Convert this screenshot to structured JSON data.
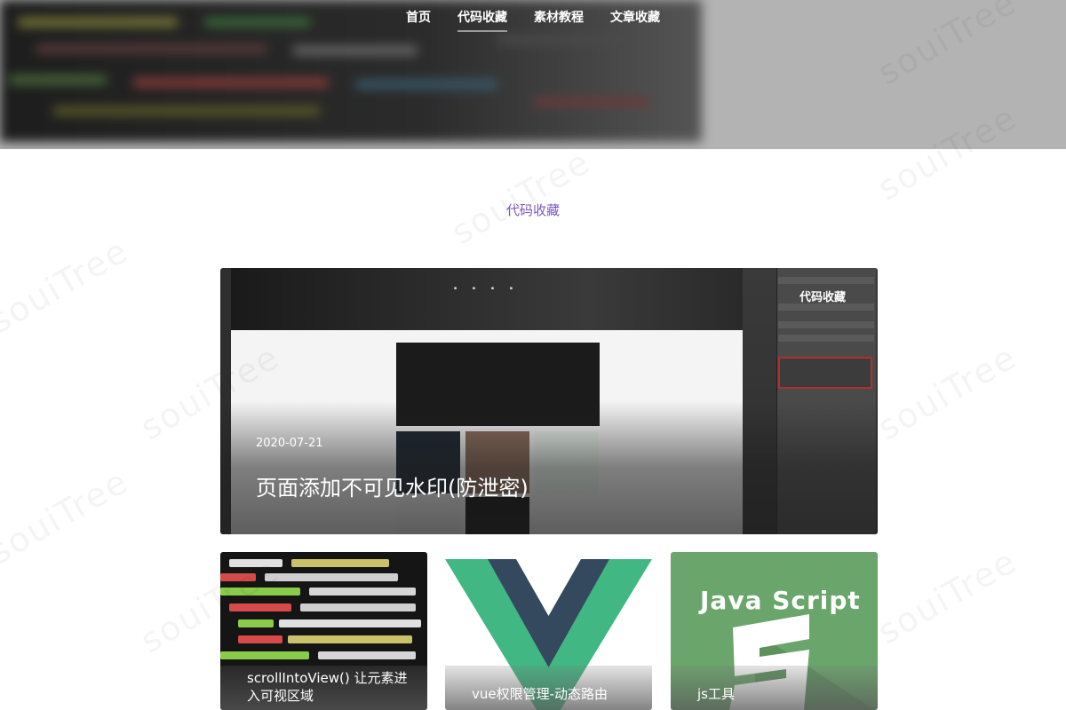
{
  "nav": {
    "items": [
      {
        "label": "首页",
        "active": false
      },
      {
        "label": "代码收藏",
        "active": true
      },
      {
        "label": "素材教程",
        "active": false
      },
      {
        "label": "文章收藏",
        "active": false
      }
    ]
  },
  "section": {
    "title": "代码收藏"
  },
  "featured": {
    "badge": "代码收藏",
    "date": "2020-07-21",
    "title": "页面添加不可见水印(防泄密)"
  },
  "cards": [
    {
      "caption": "scrollIntoView() 让元素进入可视区域"
    },
    {
      "caption": "vue权限管理-动态路由"
    },
    {
      "caption": "js工具",
      "image_text": "Java Script"
    }
  ],
  "watermark": {
    "text": "souiTree"
  },
  "colors": {
    "accent": "#7b55c7",
    "vue_green": "#41b883",
    "vue_dark": "#35495e",
    "js_green": "#6aa66b"
  }
}
